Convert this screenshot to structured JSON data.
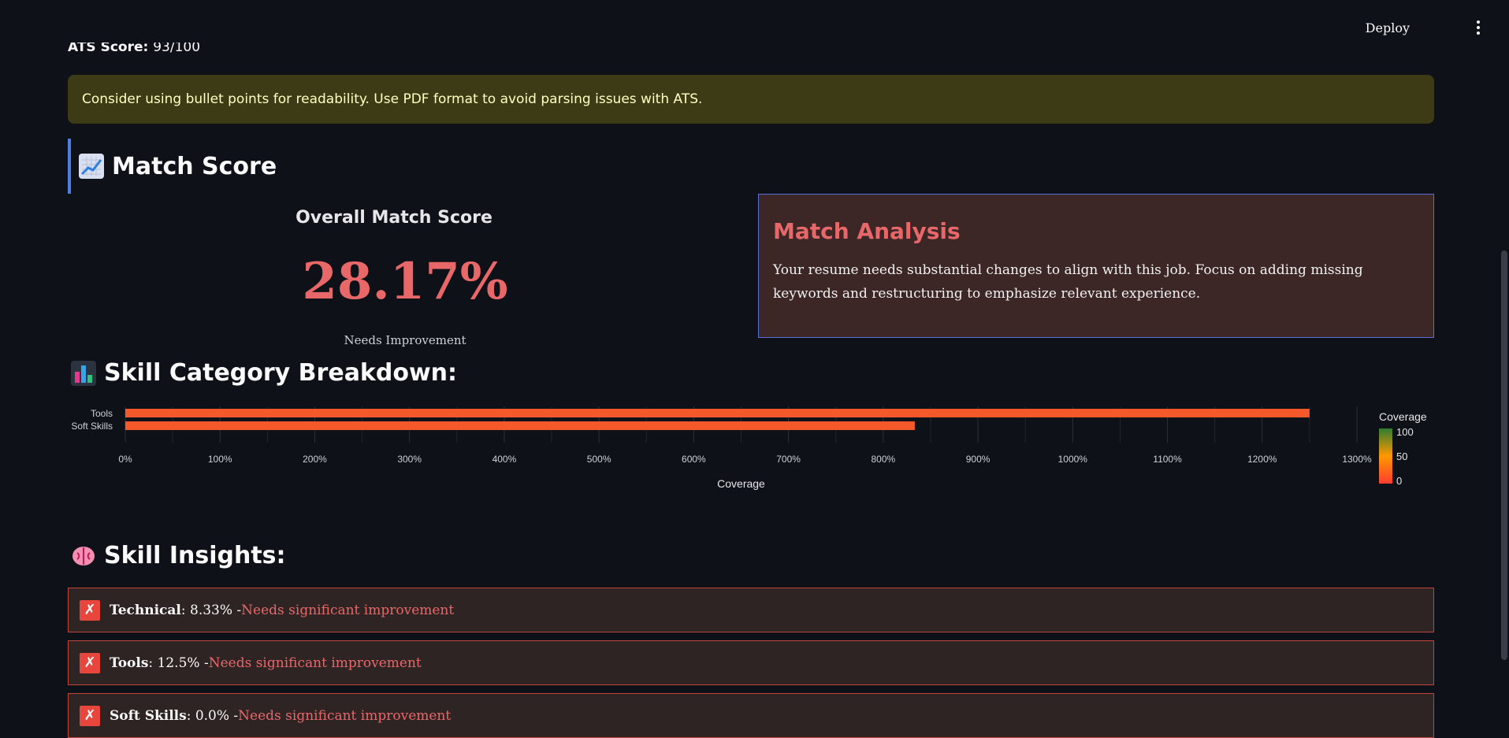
{
  "header": {
    "deploy_label": "Deploy",
    "menu_icon": "kebab-menu-icon"
  },
  "ats": {
    "label": "ATS Score:",
    "value": "93/100"
  },
  "alert": {
    "text": "Consider using bullet points for readability. Use PDF format to avoid parsing issues with ATS."
  },
  "match_section": {
    "title": "Match Score",
    "icon": "chart-increasing-icon"
  },
  "score": {
    "title": "Overall Match Score",
    "value": "28.17%",
    "status": "Needs Improvement"
  },
  "analysis": {
    "title": "Match Analysis",
    "text": "Your resume needs substantial changes to align with this job. Focus on adding missing keywords and restructuring to emphasize relevant experience."
  },
  "skill_section": {
    "title": "Skill Category Breakdown:",
    "icon": "bar-chart-icon"
  },
  "chart_data": {
    "type": "bar",
    "orientation": "horizontal",
    "categories": [
      "Tools",
      "Soft Skills"
    ],
    "values": [
      1250,
      833.33
    ],
    "xlabel": "Coverage",
    "ylabel": "",
    "xlim": [
      0,
      1300
    ],
    "xticks": [
      "0%",
      "100%",
      "200%",
      "300%",
      "400%",
      "500%",
      "600%",
      "700%",
      "800%",
      "900%",
      "1000%",
      "1100%",
      "1200%",
      "1300%"
    ],
    "bar_color": "#f4582b",
    "colorbar": {
      "title": "Coverage",
      "ticks": [
        "100",
        "50",
        "0"
      ],
      "colors": [
        "#2e7d32",
        "#ff9800",
        "#ff3d2e"
      ]
    },
    "grid": true
  },
  "insight_section": {
    "title": "Skill Insights:",
    "icon": "brain-icon"
  },
  "insights": [
    {
      "name": "Technical",
      "value": ": 8.33% - ",
      "status": "Needs significant improvement"
    },
    {
      "name": "Tools",
      "value": ": 12.5% - ",
      "status": "Needs significant improvement"
    },
    {
      "name": "Soft Skills",
      "value": ": 0.0% - ",
      "status": "Needs significant improvement"
    }
  ]
}
